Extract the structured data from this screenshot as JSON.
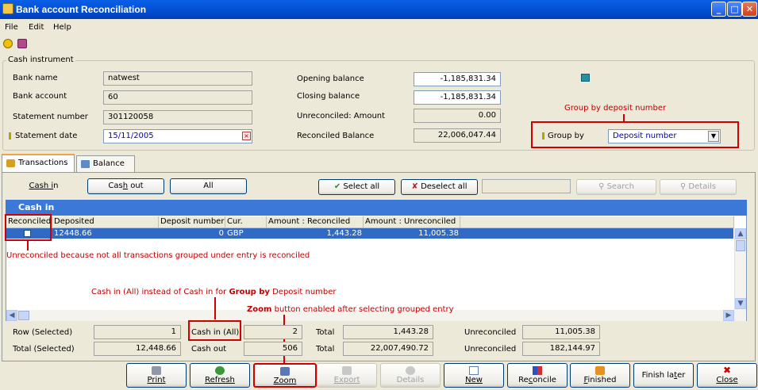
{
  "window": {
    "title": "Bank account Reconciliation",
    "min": "_",
    "max": "□",
    "close": "✕"
  },
  "menu": [
    "File",
    "Edit",
    "Help"
  ],
  "cash_instrument": {
    "legend": "Cash instrument",
    "bank_name_label": "Bank name",
    "bank_name": "natwest",
    "bank_account_label": "Bank account",
    "bank_account": "60",
    "statement_number_label": "Statement number",
    "statement_number": "301120058",
    "statement_date_label": "Statement date",
    "statement_date": "15/11/2005",
    "opening_balance_label": "Opening balance",
    "opening_balance": "-1,185,831.34",
    "closing_balance_label": "Closing balance",
    "closing_balance": "-1,185,831.34",
    "unreconciled_amount_label": "Unreconciled: Amount",
    "unreconciled_amount": "0.00",
    "reconciled_balance_label": "Reconciled Balance",
    "reconciled_balance": "22,006,047.44",
    "group_by_label": "Group by",
    "group_by_value": "Deposit number"
  },
  "annotations": {
    "group_by": "Group by deposit number",
    "unreconciled": "Unreconciled because not all transactions grouped under entry is reconciled",
    "cash_in_all_a": "Cash in (All) instead of Cash in for ",
    "cash_in_all_b": "Group by",
    "cash_in_all_c": " Deposit number",
    "zoom_a": "Zoom",
    "zoom_b": " button enabled after selecting grouped entry"
  },
  "tabs": [
    "Transactions",
    "Balance"
  ],
  "filter_buttons": {
    "cash_in": "Cash in",
    "cash_out": "Cash out",
    "all": "All",
    "select_all": "Select all",
    "deselect_all": "Deselect all",
    "search": "Search",
    "details": "Details"
  },
  "grid": {
    "caption": "Cash in",
    "columns": [
      "Reconciled",
      "Deposited",
      "Deposit number",
      "Cur.",
      "Amount : Reconciled",
      "Amount : Unreconciled"
    ],
    "row": {
      "deposited": "12448.66",
      "deposit_number": "0",
      "currency": "GBP",
      "amount_reconciled": "1,443.28",
      "amount_unreconciled": "11,005.38"
    }
  },
  "summary": {
    "row_selected_label": "Row (Selected)",
    "row_selected_value": "1",
    "total_selected_label": "Total (Selected)",
    "total_selected_value": "12,448.66",
    "cash_in_all_label": "Cash in (All)",
    "cash_in_all_value": "2",
    "cash_out_label": "Cash out",
    "cash_out_value": "506",
    "total_label": "Total",
    "total_in": "1,443.28",
    "total_out": "22,007,490.72",
    "unreconciled_label": "Unreconciled",
    "unreconciled_in": "11,005.38",
    "unreconciled_out": "182,144.97"
  },
  "bottom_buttons": {
    "print": "Print",
    "refresh": "Refresh",
    "zoom": "Zoom",
    "export": "Export",
    "details": "Details",
    "new": "New",
    "reconcile": "Reconcile",
    "finished": "Finished",
    "finish_later": "Finish later",
    "close": "Close"
  },
  "colors": {
    "accent": "#316AC5",
    "annotation": "#D00000",
    "caption": "#3C78D8"
  }
}
